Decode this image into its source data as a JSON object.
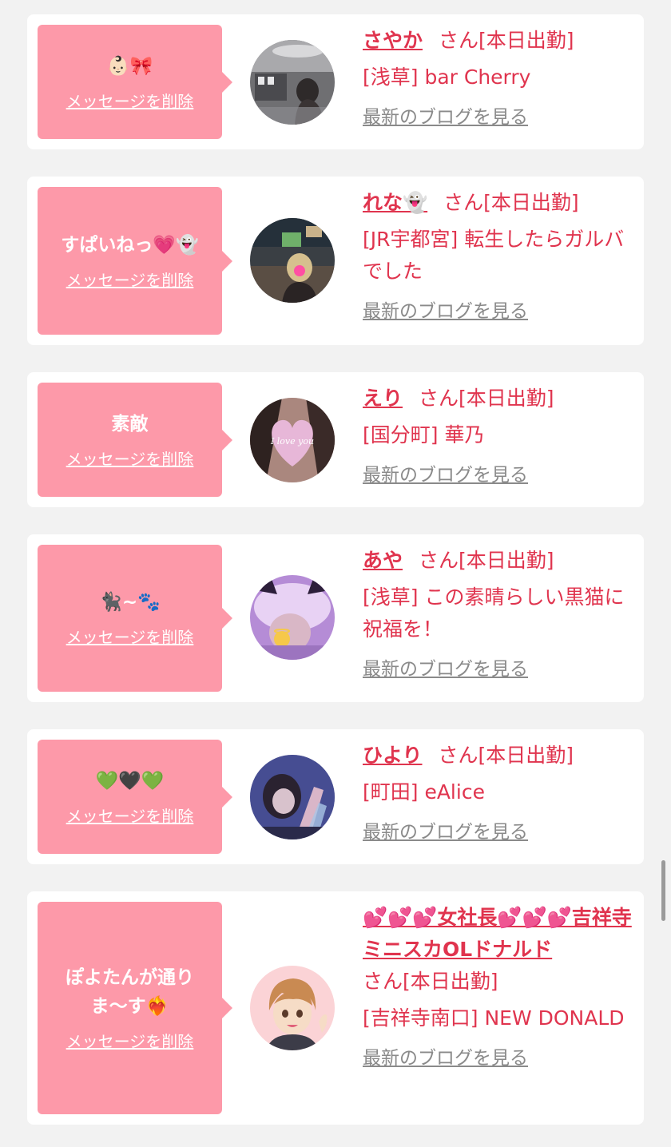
{
  "items": [
    {
      "message": "👶🏻🎀",
      "delete_label": "メッセージを削除",
      "name": "さやか",
      "status": "さん[本日出勤]",
      "shop": "[浅草] bar Cherry",
      "blog_label": "最新のブログを見る"
    },
    {
      "message": "すぱいねっ💗👻",
      "delete_label": "メッセージを削除",
      "name": "れな👻",
      "status": "さん[本日出勤]",
      "shop": "[JR宇都宮] 転生したらガルバでした",
      "blog_label": "最新のブログを見る"
    },
    {
      "message": "素敵",
      "delete_label": "メッセージを削除",
      "name": "えり",
      "status": "さん[本日出勤]",
      "shop": "[国分町] 華乃",
      "blog_label": "最新のブログを見る"
    },
    {
      "message": "🐈‍⬛~🐾",
      "delete_label": "メッセージを削除",
      "name": "あや",
      "status": "さん[本日出勤]",
      "shop": "[浅草] この素晴らしい黒猫に祝福を！",
      "blog_label": "最新のブログを見る"
    },
    {
      "message": "💚🖤💚",
      "delete_label": "メッセージを削除",
      "name": "ひより",
      "status": "さん[本日出勤]",
      "shop": "[町田] eAlice",
      "blog_label": "最新のブログを見る"
    },
    {
      "message": "ぽよたんが通りま〜す❤️‍🔥",
      "delete_label": "メッセージを削除",
      "name": "💕💕💕女社長💕💕💕吉祥寺ミニスカOLドナルド",
      "status": "さん[本日出勤]",
      "shop": "[吉祥寺南口] NEW DONALD",
      "blog_label": "最新のブログを見る"
    }
  ],
  "colors": {
    "bubble": "#fd99a9",
    "accent": "#e0344e",
    "link_gray": "#8a8a8a",
    "background": "#f2f2f2"
  }
}
